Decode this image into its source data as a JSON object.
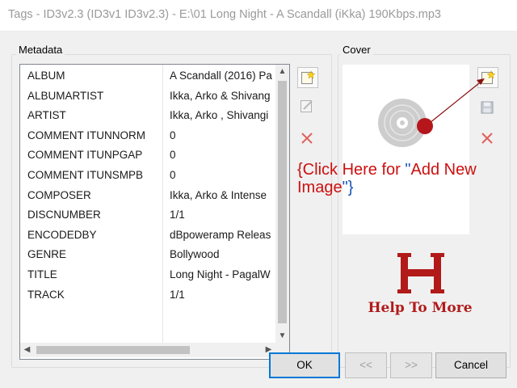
{
  "window": {
    "title": "Tags - ID3v2.3 (ID3v1 ID3v2.3) - E:\\01 Long Night - A Scandall (iKka) 190Kbps.mp3"
  },
  "metadata": {
    "label": "Metadata",
    "rows": [
      {
        "key": "ALBUM",
        "value": "A Scandall (2016) Pa"
      },
      {
        "key": "ALBUMARTIST",
        "value": "Ikka, Arko & Shivang"
      },
      {
        "key": "ARTIST",
        "value": "Ikka, Arko , Shivangi"
      },
      {
        "key": "COMMENT ITUNNORM",
        "value": "0"
      },
      {
        "key": "COMMENT ITUNPGAP",
        "value": "0"
      },
      {
        "key": "COMMENT ITUNSMPB",
        "value": "0"
      },
      {
        "key": "COMPOSER",
        "value": "Ikka, Arko & Intense"
      },
      {
        "key": "DISCNUMBER",
        "value": "1/1"
      },
      {
        "key": "ENCODEDBY",
        "value": "dBpoweramp Releas"
      },
      {
        "key": "GENRE",
        "value": "Bollywood"
      },
      {
        "key": "TITLE",
        "value": "Long Night - PagalW"
      },
      {
        "key": "TRACK",
        "value": "1/1"
      }
    ],
    "tools": [
      "add-tag-icon",
      "edit-tag-icon",
      "delete-tag-icon"
    ]
  },
  "cover": {
    "label": "Cover",
    "tools": [
      "add-image-icon",
      "save-image-icon",
      "delete-image-icon"
    ]
  },
  "annotation": {
    "open": "{Click Here for ",
    "q1": "\"",
    "mid": "Add New Image",
    "q2": "\"",
    "close": "}"
  },
  "logo": {
    "text": "Help To More"
  },
  "buttons": {
    "ok": "OK",
    "prev": "<<",
    "next": ">>",
    "cancel": "Cancel"
  },
  "colors": {
    "accent": "#0078d7",
    "annotation_red": "#cc1010",
    "annotation_blue": "#1a54b8",
    "logo_red": "#b21a1a"
  }
}
